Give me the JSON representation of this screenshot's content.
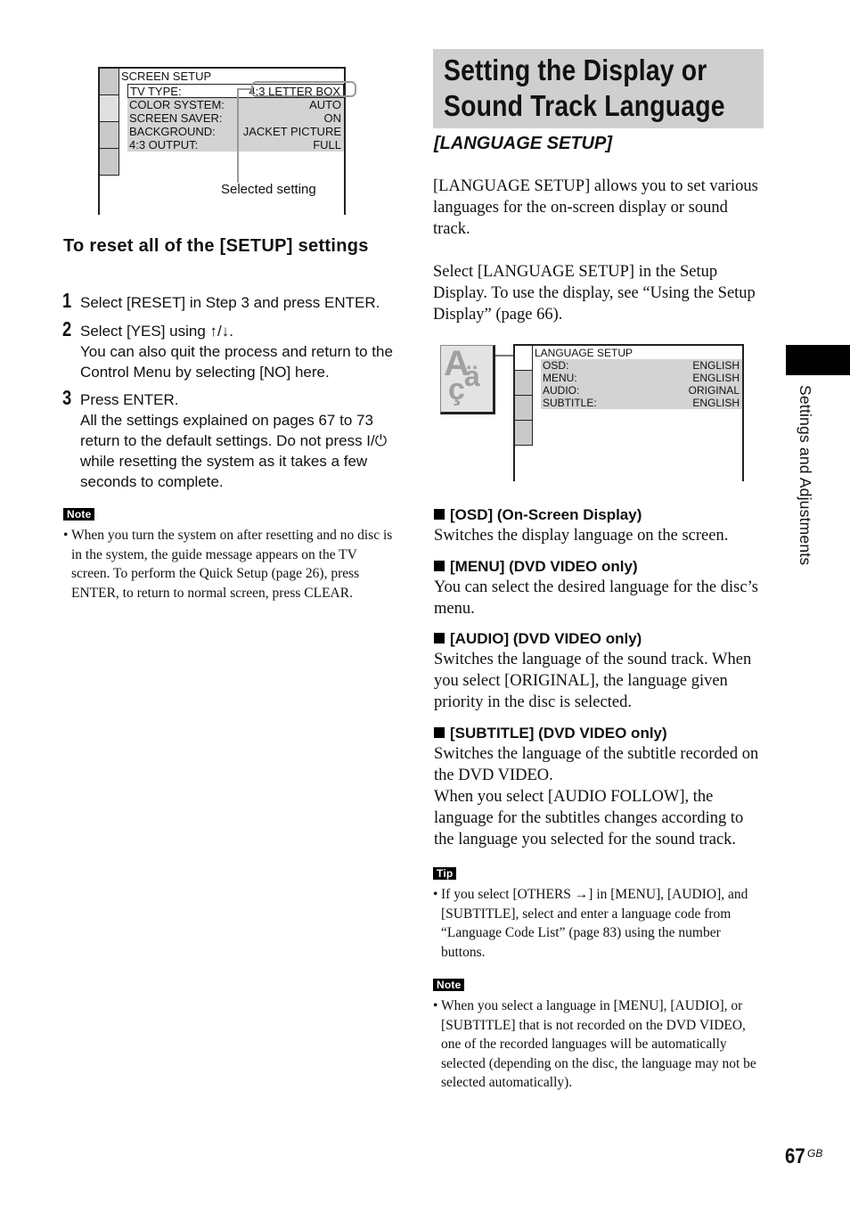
{
  "screen_setup_diagram": {
    "title": "SCREEN SETUP",
    "rows": [
      {
        "label": "TV TYPE:",
        "value": "4:3 LETTER BOX",
        "selected": true
      },
      {
        "label": "COLOR SYSTEM:",
        "value": "AUTO"
      },
      {
        "label": "SCREEN SAVER:",
        "value": "ON"
      },
      {
        "label": "BACKGROUND:",
        "value": "JACKET PICTURE"
      },
      {
        "label": "4:3 OUTPUT:",
        "value": "FULL"
      }
    ],
    "callout": "Selected setting"
  },
  "reset_section": {
    "heading": "To reset all of the [SETUP] settings",
    "steps": [
      {
        "num": "1",
        "lines": [
          "Select [RESET] in Step 3 and press ENTER."
        ]
      },
      {
        "num": "2",
        "lines": [
          "Select [YES] using ↑/↓.",
          "You can also quit the process and return to the Control Menu by selecting [NO] here."
        ]
      },
      {
        "num": "3",
        "lines": [
          "Press ENTER.",
          "All the settings explained on pages 67 to 73 return to the default settings. Do not press I/⏻ while resetting the system as it takes a few seconds to complete."
        ]
      }
    ],
    "note_label": "Note",
    "note": "When you turn the system on after resetting and no disc is in the system, the guide message appears on the TV screen. To perform the Quick Setup (page 26), press ENTER, to return to normal screen, press CLEAR."
  },
  "main": {
    "title_line1": "Setting the Display or",
    "title_line2": "Sound Track Language",
    "subtitle": "[LANGUAGE SETUP]",
    "intro1": "[LANGUAGE SETUP] allows you to set various languages for the on-screen display or sound track.",
    "intro2": "Select [LANGUAGE SETUP] in the Setup Display. To use the display, see “Using the Setup Display” (page 66).",
    "icon": "language-setup-icon",
    "language_diagram": {
      "title": "LANGUAGE SETUP",
      "rows": [
        {
          "label": "OSD:",
          "value": "ENGLISH"
        },
        {
          "label": "MENU:",
          "value": "ENGLISH"
        },
        {
          "label": "AUDIO:",
          "value": "ORIGINAL"
        },
        {
          "label": "SUBTITLE:",
          "value": "ENGLISH"
        }
      ]
    },
    "sections": [
      {
        "heading": "[OSD] (On-Screen Display)",
        "body": "Switches the display language on the screen."
      },
      {
        "heading": "[MENU] (DVD VIDEO only)",
        "body": "You can select the desired language for the disc’s menu."
      },
      {
        "heading": "[AUDIO] (DVD VIDEO only)",
        "body": "Switches the language of the sound track. When you select [ORIGINAL], the language given priority in the disc is selected."
      },
      {
        "heading": "[SUBTITLE] (DVD VIDEO only)",
        "body": "Switches the language of the subtitle recorded on the DVD VIDEO.",
        "body2": "When you select [AUDIO FOLLOW], the language for the subtitles changes according to the language you selected for the sound track."
      }
    ],
    "tip_label": "Tip",
    "tip": "If you select [OTHERS →] in [MENU], [AUDIO], and [SUBTITLE], select and enter a language code from “Language Code List” (page 83) using the number buttons.",
    "note_label": "Note",
    "note": "When you select a language in [MENU], [AUDIO], or [SUBTITLE] that is not recorded on the DVD VIDEO, one of the recorded languages will be automatically selected (depending on the disc, the language may not be selected automatically)."
  },
  "side_tab": {
    "label": "Settings and Adjustments"
  },
  "footer": {
    "page_number": "67",
    "region": "GB"
  }
}
